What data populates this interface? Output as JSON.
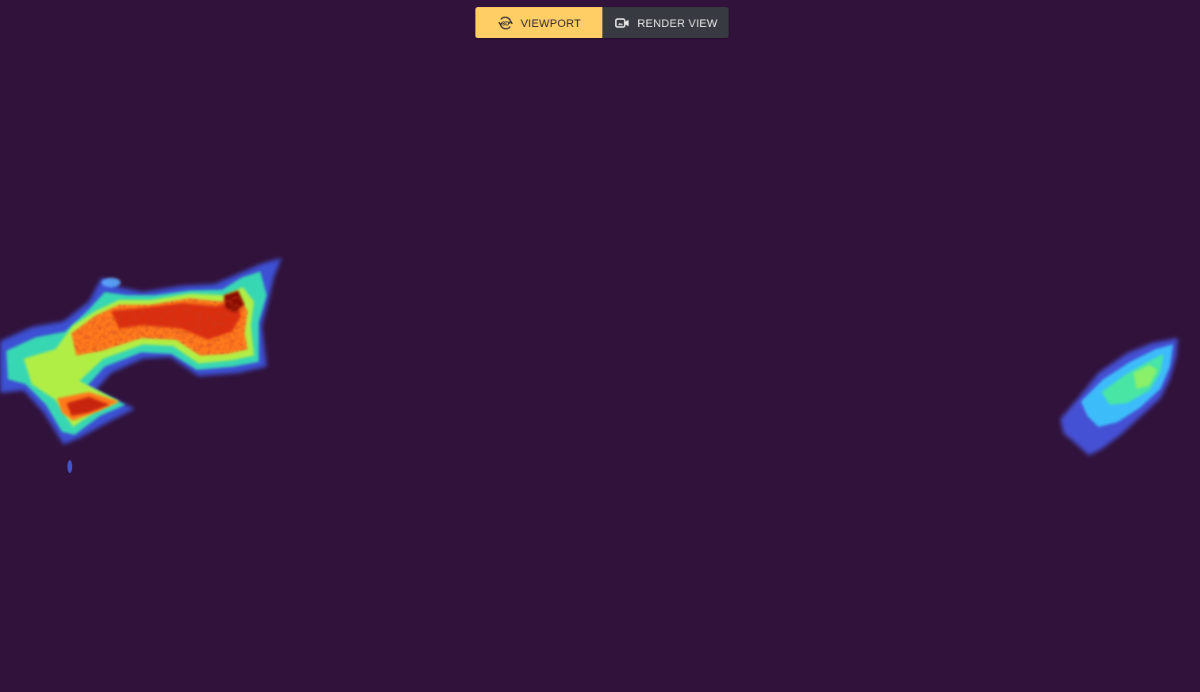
{
  "toolbar": {
    "viewport_label": "VIEWPORT",
    "render_label": "RENDER VIEW",
    "viewport_icon": "3d-rotate-icon",
    "render_icon": "video-camera-icon",
    "active_mode": "viewport",
    "active_color": "#ffcf66",
    "inactive_color": "#373a40"
  },
  "scene": {
    "background_color": "#31123a",
    "colormap": "turbo"
  }
}
